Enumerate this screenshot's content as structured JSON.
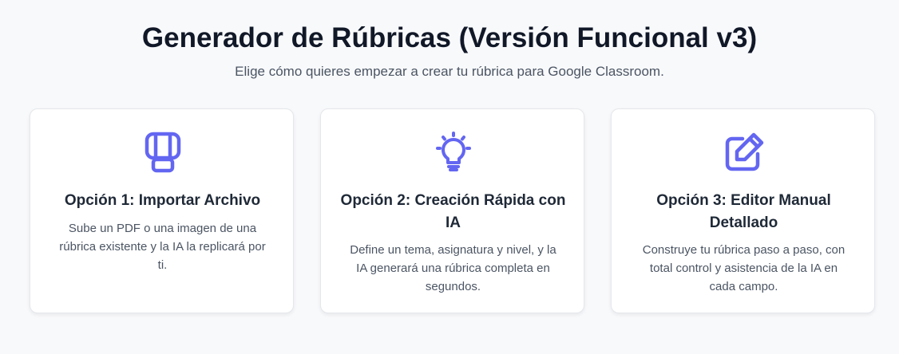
{
  "header": {
    "title": "Generador de Rúbricas (Versión Funcional v3)",
    "subtitle": "Elige cómo quieres empezar a crear tu rúbrica para Google Classroom."
  },
  "options": [
    {
      "icon": "import-document-icon",
      "title": "Opción 1: Importar Archivo",
      "description": "Sube un PDF o una imagen de una rúbrica existente y la IA la replicará por ti."
    },
    {
      "icon": "lightbulb-icon",
      "title": "Opción 2: Creación Rápida con IA",
      "description": "Define un tema, asignatura y nivel, y la IA generará una rúbrica completa en segundos."
    },
    {
      "icon": "edit-pencil-icon",
      "title": "Opción 3: Editor Manual Detallado",
      "description": "Construye tu rúbrica paso a paso, con total control y asistencia de la IA en cada campo."
    }
  ],
  "colors": {
    "accent": "#6366f1",
    "background": "#f8f9fb",
    "card": "#ffffff",
    "title": "#111827",
    "text": "#4b5563"
  }
}
